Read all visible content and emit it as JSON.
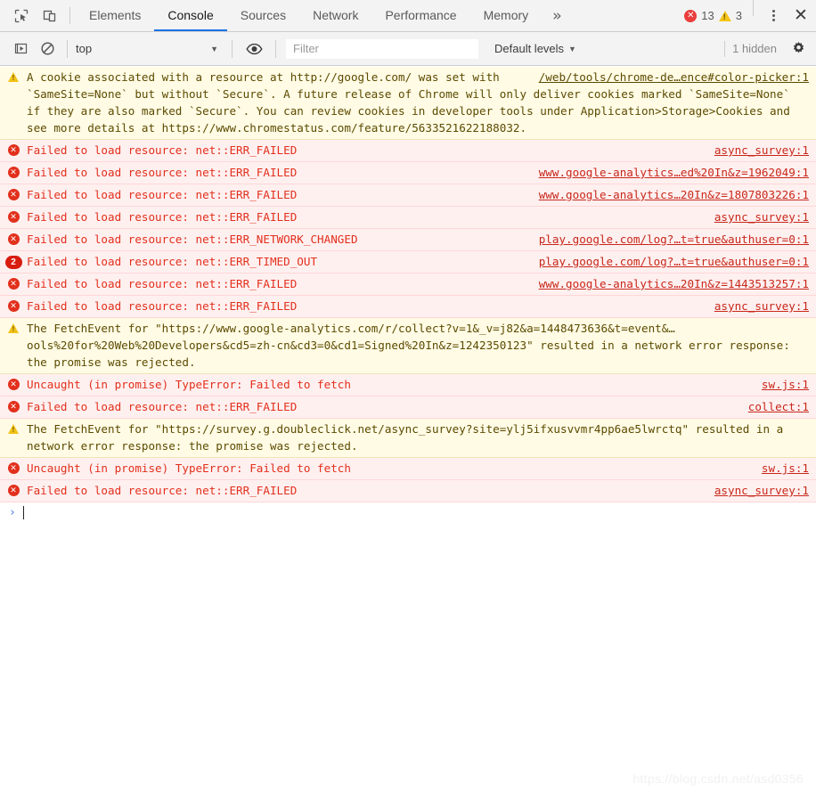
{
  "window": {
    "title": "Chrome DevTools — Console"
  },
  "tabbar": {
    "icons": [
      {
        "name": "inspect-element-icon",
        "label": "Inspect element"
      },
      {
        "name": "device-toolbar-icon",
        "label": "Toggle device toolbar"
      }
    ],
    "tabs": [
      {
        "label": "Elements",
        "active": false
      },
      {
        "label": "Console",
        "active": true
      },
      {
        "label": "Sources",
        "active": false
      },
      {
        "label": "Network",
        "active": false
      },
      {
        "label": "Performance",
        "active": false
      },
      {
        "label": "Memory",
        "active": false
      }
    ],
    "more_label": "»",
    "error_count": "13",
    "warning_count": "3",
    "error_badge_glyph": "✕",
    "close_label": "✕",
    "colors": {
      "error": "#ec3d3d",
      "warning": "#f5c518",
      "active_tab_underline": "#1a73e8"
    }
  },
  "console_toolbar": {
    "execute_icon": "resume-script-icon",
    "clear_icon": "clear-console-icon",
    "context_value": "top",
    "context_caret": "▼",
    "eye_icon": "live-expression-eye-icon",
    "filter_placeholder": "Filter",
    "filter_value": "",
    "levels_label": "Default levels",
    "levels_caret": "▼",
    "hidden_label": "1 hidden",
    "settings_icon": "gear-icon"
  },
  "messages": [
    {
      "type": "warning",
      "icon": "warning-icon",
      "layout": "block",
      "source": "/web/tools/chrome-de…ence#color-picker:1",
      "parts": [
        {
          "t": "text",
          "v": "A cookie associated with a resource at "
        },
        {
          "t": "link",
          "v": "http://google.com/"
        },
        {
          "t": "text",
          "v": " was set with `SameSite=None` but without `Secure`. A future release of Chrome will only deliver cookies marked `SameSite=None` if they are also marked `Secure`. You can review cookies in developer tools under Application>Storage>Cookies and see more details at "
        },
        {
          "t": "link",
          "v": "https://www.chromestatus.com/feature/5633521622188032"
        },
        {
          "t": "text",
          "v": "."
        }
      ]
    },
    {
      "type": "error",
      "icon": "error-icon",
      "layout": "row",
      "text": "Failed to load resource: net::ERR_FAILED",
      "source": "async_survey:1"
    },
    {
      "type": "error",
      "icon": "error-icon",
      "layout": "row",
      "text": "Failed to load resource: net::ERR_FAILED",
      "source": "www.google-analytics…ed%20In&z=1962049:1"
    },
    {
      "type": "error",
      "icon": "error-icon",
      "layout": "row",
      "text": "Failed to load resource: net::ERR_FAILED",
      "source": "www.google-analytics…20In&z=1807803226:1"
    },
    {
      "type": "error",
      "icon": "error-icon",
      "layout": "row",
      "text": "Failed to load resource: net::ERR_FAILED",
      "source": "async_survey:1"
    },
    {
      "type": "error",
      "icon": "error-icon",
      "layout": "row",
      "text": "Failed to load resource: net::ERR_NETWORK_CHANGED",
      "source": "play.google.com/log?…t=true&authuser=0:1"
    },
    {
      "type": "error",
      "icon": "repeat-count-badge",
      "count": "2",
      "layout": "row",
      "text": "Failed to load resource: net::ERR_TIMED_OUT",
      "source": "play.google.com/log?…t=true&authuser=0:1"
    },
    {
      "type": "error",
      "icon": "error-icon",
      "layout": "row",
      "text": "Failed to load resource: net::ERR_FAILED",
      "source": "www.google-analytics…20In&z=1443513257:1"
    },
    {
      "type": "error",
      "icon": "error-icon",
      "layout": "row",
      "text": "Failed to load resource: net::ERR_FAILED",
      "source": "async_survey:1"
    },
    {
      "type": "warning",
      "icon": "warning-icon",
      "layout": "block",
      "source": "",
      "parts": [
        {
          "t": "text",
          "v": "The FetchEvent for \""
        },
        {
          "t": "link",
          "v": "https://www.google-analytics.com/r/collect?v=1&_v=j82&a=1448473636&t=event&…ools%20for%20Web%20Developers&cd5=zh-cn&cd3=0&cd1=Signed%20In&z=1242350123"
        },
        {
          "t": "text",
          "v": "\" resulted in a network error response: the promise was rejected."
        }
      ]
    },
    {
      "type": "error",
      "icon": "error-icon",
      "layout": "row",
      "text": "Uncaught (in promise) TypeError: Failed to fetch",
      "source": "sw.js:1"
    },
    {
      "type": "error",
      "icon": "error-icon",
      "layout": "row",
      "text": "Failed to load resource: net::ERR_FAILED",
      "source": "collect:1"
    },
    {
      "type": "warning",
      "icon": "warning-icon",
      "layout": "block",
      "source": "",
      "parts": [
        {
          "t": "text",
          "v": "The FetchEvent for \""
        },
        {
          "t": "link",
          "v": "https://survey.g.doubleclick.net/async_survey?site=ylj5ifxusvvmr4pp6ae5lwrctq"
        },
        {
          "t": "text",
          "v": "\" resulted in a network error response: the promise was rejected."
        }
      ]
    },
    {
      "type": "error",
      "icon": "error-icon",
      "layout": "row",
      "text": "Uncaught (in promise) TypeError: Failed to fetch",
      "source": "sw.js:1"
    },
    {
      "type": "error",
      "icon": "error-icon",
      "layout": "row",
      "text": "Failed to load resource: net::ERR_FAILED",
      "source": "async_survey:1"
    }
  ],
  "prompt": {
    "chevron": "›",
    "value": ""
  },
  "watermark": {
    "text": "https://blog.csdn.net/asd0356"
  }
}
